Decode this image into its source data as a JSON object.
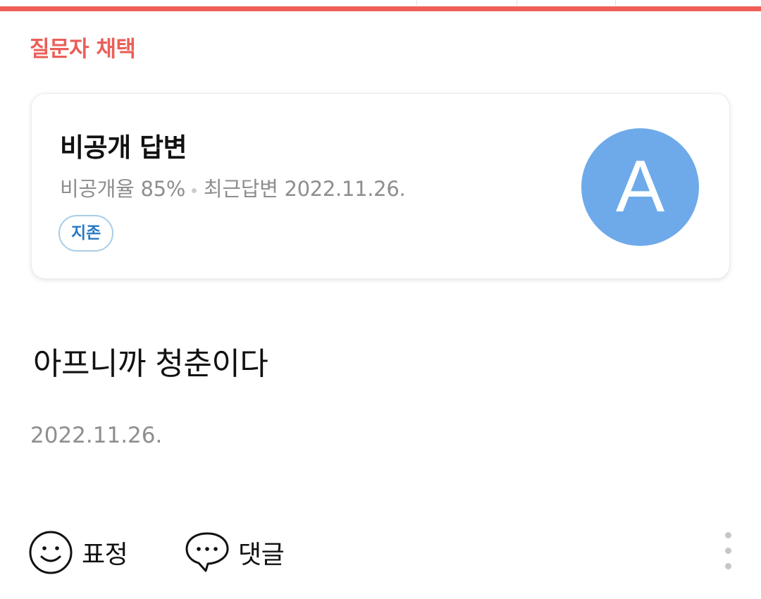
{
  "section": {
    "label": "질문자 채택",
    "accent_color": "#ef5f57"
  },
  "card": {
    "title": "비공개 답변",
    "private_rate": "비공개율 85%",
    "recent_answer": "최근답변 2022.11.26.",
    "badge": "지존",
    "avatar_letter": "A",
    "avatar_color": "#6eaaea"
  },
  "answer": {
    "text": "아프니까 청춘이다",
    "date": "2022.11.26."
  },
  "actions": {
    "emoji_label": "표정",
    "emoji_icon": "smiley-icon",
    "comment_label": "댓글",
    "comment_icon": "speech-bubble-icon",
    "more_icon": "more-vertical-icon"
  }
}
